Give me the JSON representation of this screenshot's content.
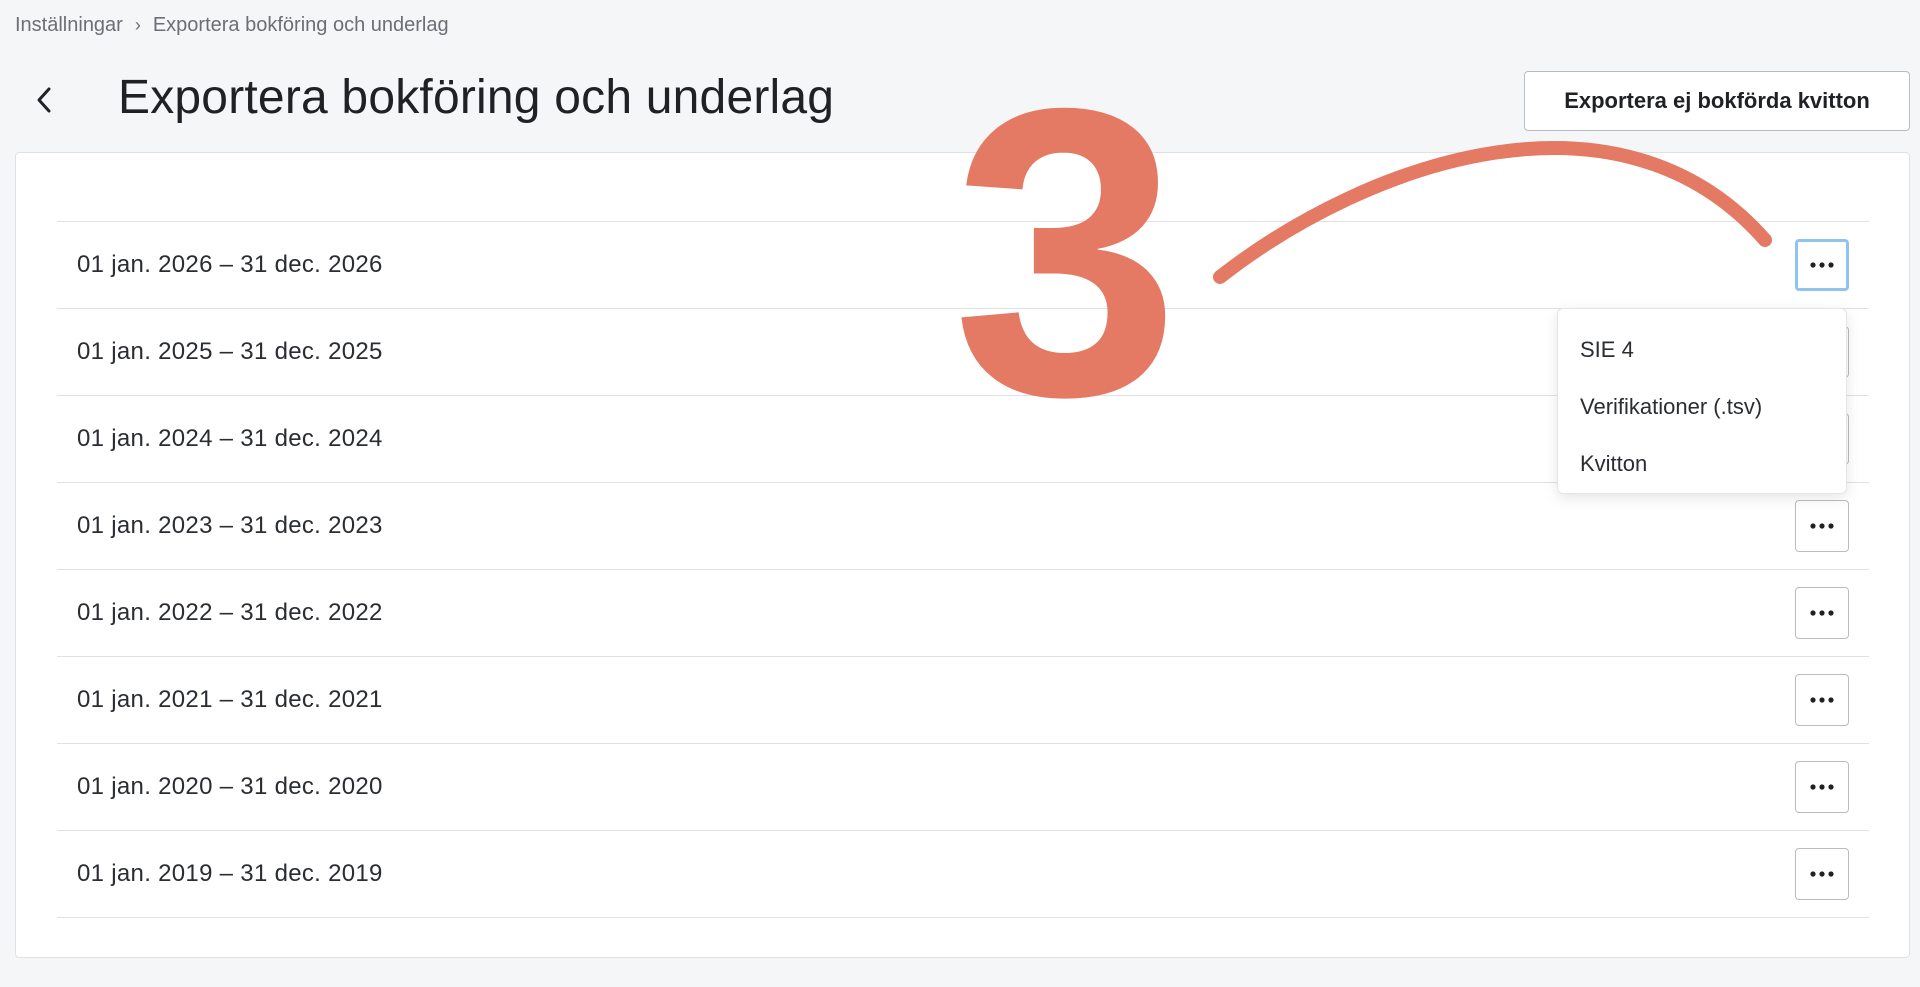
{
  "breadcrumb": {
    "parent": "Inställningar",
    "separator": "›",
    "current": "Exportera bokföring och underlag"
  },
  "header": {
    "title": "Exportera bokföring och underlag",
    "export_unbooked_label": "Exportera ej bokförda kvitton"
  },
  "periods": [
    {
      "label": "01 jan. 2026 – 31 dec. 2026",
      "menu_open": true
    },
    {
      "label": "01 jan. 2025 – 31 dec. 2025",
      "menu_open": false
    },
    {
      "label": "01 jan. 2024 – 31 dec. 2024",
      "menu_open": false
    },
    {
      "label": "01 jan. 2023 – 31 dec. 2023",
      "menu_open": false
    },
    {
      "label": "01 jan. 2022 – 31 dec. 2022",
      "menu_open": false
    },
    {
      "label": "01 jan. 2021 – 31 dec. 2021",
      "menu_open": false
    },
    {
      "label": "01 jan. 2020 – 31 dec. 2020",
      "menu_open": false
    },
    {
      "label": "01 jan. 2019 – 31 dec. 2019",
      "menu_open": false
    }
  ],
  "dropdown": {
    "items": [
      "SIE 4",
      "Verifikationer (.tsv)",
      "Kvitton"
    ]
  },
  "annotation": {
    "step_number": "3",
    "color": "#e57a64"
  },
  "icons": {
    "back": "chevron-left-icon",
    "more": "more-horizontal-icon"
  }
}
